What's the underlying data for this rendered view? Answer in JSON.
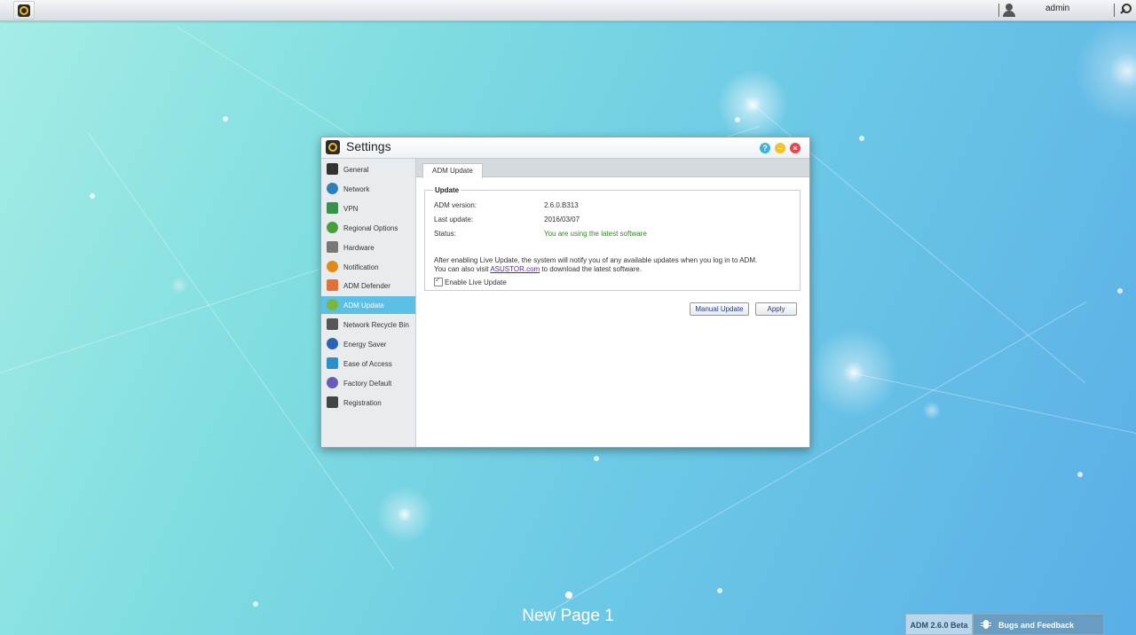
{
  "taskbar": {
    "user": "admin"
  },
  "window": {
    "title": "Settings",
    "help_glyph": "?",
    "min_glyph": "–",
    "close_glyph": "×"
  },
  "sidebar": {
    "items": [
      {
        "label": "General",
        "icon": "general-icon",
        "color": "#333333"
      },
      {
        "label": "Network",
        "icon": "network-globe-icon",
        "color": "#2d7fb8"
      },
      {
        "label": "VPN",
        "icon": "vpn-icon",
        "color": "#3a8f4c"
      },
      {
        "label": "Regional Options",
        "icon": "regional-options-icon",
        "color": "#4a9c3c"
      },
      {
        "label": "Hardware",
        "icon": "hardware-icon",
        "color": "#777777"
      },
      {
        "label": "Notification",
        "icon": "notification-icon",
        "color": "#e08a1b"
      },
      {
        "label": "ADM Defender",
        "icon": "adm-defender-icon",
        "color": "#e0703a"
      },
      {
        "label": "ADM Update",
        "icon": "adm-update-icon",
        "color": "#7ab83a"
      },
      {
        "label": "Network Recycle Bin",
        "icon": "recycle-bin-icon",
        "color": "#555555"
      },
      {
        "label": "Energy Saver",
        "icon": "energy-saver-icon",
        "color": "#2a62b6"
      },
      {
        "label": "Ease of Access",
        "icon": "ease-of-access-icon",
        "color": "#2e8fc8"
      },
      {
        "label": "Factory Default",
        "icon": "factory-default-icon",
        "color": "#6b5bb8"
      },
      {
        "label": "Registration",
        "icon": "registration-icon",
        "color": "#444444"
      }
    ],
    "active_index": 7
  },
  "tab": {
    "label": "ADM Update"
  },
  "update": {
    "legend": "Update",
    "rows": [
      {
        "label": "ADM version:",
        "value": "2.6.0.B313"
      },
      {
        "label": "Last update:",
        "value": "2016/03/07"
      },
      {
        "label": "Status:",
        "value": "You are using the latest software"
      }
    ],
    "info_line1": "After enabling Live Update, the system will notify you of any available updates when you log in to ADM.",
    "info_line2_prefix": "You can also visit ",
    "info_link": "ASUSTOR.com",
    "info_line2_suffix": " to download the latest software.",
    "live_update_label": "Enable Live Update",
    "live_update_checked": true
  },
  "buttons": {
    "manual_update": "Manual Update",
    "apply": "Apply"
  },
  "desktop": {
    "page_title": "New Page 1",
    "version_badge": "ADM 2.6.0 Beta",
    "feedback_label": "Bugs and Feedback"
  }
}
